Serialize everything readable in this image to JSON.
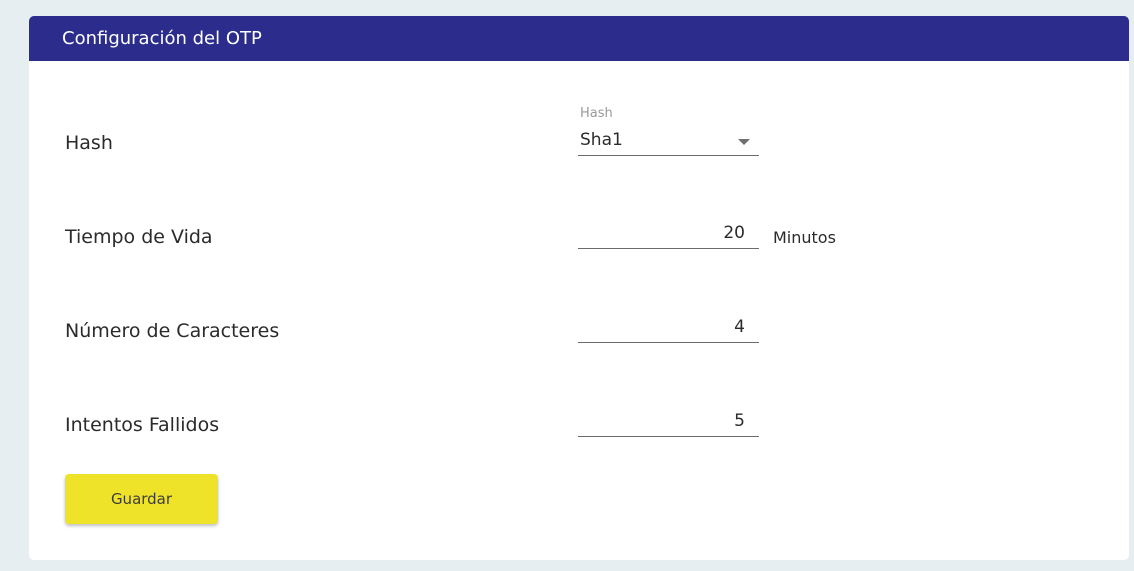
{
  "header": {
    "title": "Configuración del OTP"
  },
  "rows": {
    "hash": {
      "label": "Hash",
      "floating_label": "Hash",
      "value": "Sha1"
    },
    "lifetime": {
      "label": "Tiempo de Vida",
      "value": "20",
      "unit": "Minutos"
    },
    "chars": {
      "label": "Número de Caracteres",
      "value": "4"
    },
    "attempts": {
      "label": "Intentos Fallidos",
      "value": "5"
    }
  },
  "actions": {
    "save_label": "Guardar"
  },
  "colors": {
    "header_bg": "#2b2c8c",
    "button_bg": "#efe32a",
    "page_bg": "#e7eef2"
  }
}
